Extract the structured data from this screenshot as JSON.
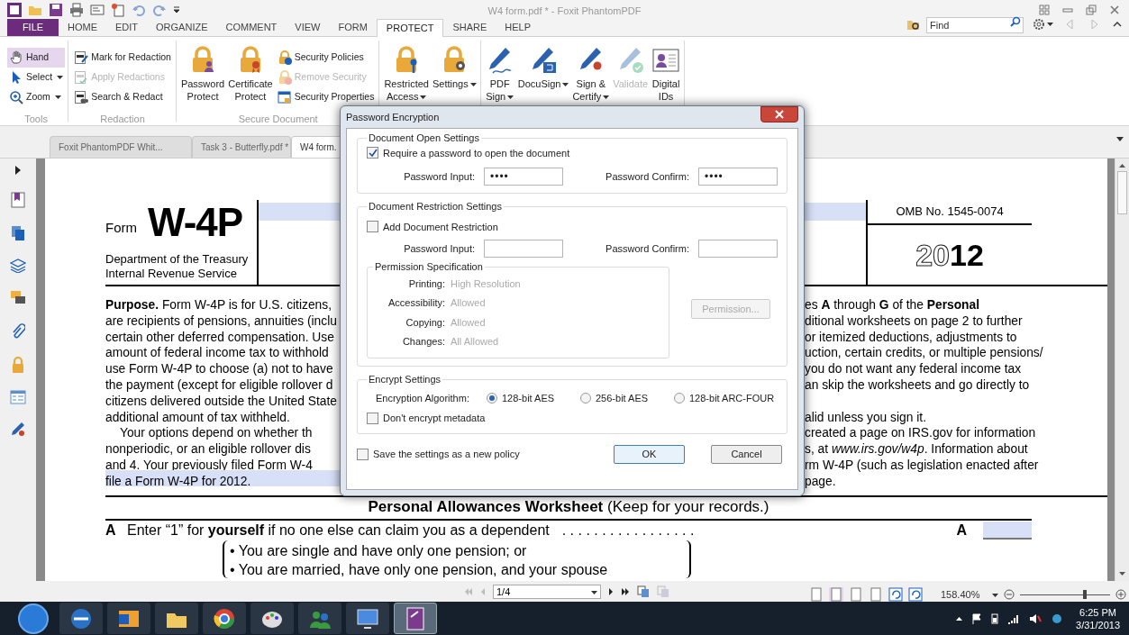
{
  "window": {
    "title": "W4 form.pdf * - Foxit PhantomPDF"
  },
  "menu_tabs": [
    {
      "label": "FILE",
      "kind": "file",
      "selected": false
    },
    {
      "label": "HOME",
      "kind": "tab",
      "selected": false
    },
    {
      "label": "EDIT",
      "kind": "tab",
      "selected": false
    },
    {
      "label": "ORGANIZE",
      "kind": "tab",
      "selected": false
    },
    {
      "label": "COMMENT",
      "kind": "tab",
      "selected": false
    },
    {
      "label": "VIEW",
      "kind": "tab",
      "selected": false
    },
    {
      "label": "FORM",
      "kind": "tab",
      "selected": false
    },
    {
      "label": "PROTECT",
      "kind": "tab",
      "selected": true
    },
    {
      "label": "SHARE",
      "kind": "tab",
      "selected": false
    },
    {
      "label": "HELP",
      "kind": "tab",
      "selected": false
    }
  ],
  "find": {
    "placeholder": "Find"
  },
  "ribbon_groups": [
    {
      "label": "Tools",
      "items": [
        {
          "kind": "small",
          "lines": [
            "Hand"
          ],
          "selected": true,
          "disabled": false,
          "dropdown": false
        },
        {
          "kind": "small",
          "lines": [
            "Select"
          ],
          "selected": false,
          "disabled": false,
          "dropdown": true
        },
        {
          "kind": "small",
          "lines": [
            "Zoom"
          ],
          "selected": false,
          "disabled": false,
          "dropdown": true
        }
      ]
    },
    {
      "label": "Redaction",
      "items": [
        {
          "kind": "small",
          "lines": [
            "Mark for Redaction"
          ],
          "disabled": false,
          "dropdown": false
        },
        {
          "kind": "small",
          "lines": [
            "Apply Redactions"
          ],
          "disabled": true,
          "dropdown": false
        },
        {
          "kind": "small",
          "lines": [
            "Search & Redact"
          ],
          "disabled": false,
          "dropdown": false
        }
      ]
    },
    {
      "label": "Secure Document",
      "items": [
        {
          "kind": "large",
          "lines": [
            "Password",
            "Protect"
          ],
          "disabled": false,
          "dropdown": false
        },
        {
          "kind": "large",
          "lines": [
            "Certificate",
            "Protect"
          ],
          "disabled": false,
          "dropdown": false
        },
        {
          "kind": "small",
          "lines": [
            "Security Policies"
          ],
          "disabled": false,
          "dropdown": false
        },
        {
          "kind": "small",
          "lines": [
            "Remove Security"
          ],
          "disabled": true,
          "dropdown": false
        },
        {
          "kind": "small",
          "lines": [
            "Security Properties"
          ],
          "disabled": false,
          "dropdown": false
        }
      ]
    },
    {
      "items": [
        {
          "kind": "large",
          "lines": [
            "Restricted",
            "Access"
          ],
          "disabled": false,
          "dropdown": true
        },
        {
          "kind": "large",
          "lines": [
            "Settings"
          ],
          "disabled": false,
          "dropdown": true
        }
      ]
    },
    {
      "items": [
        {
          "kind": "large",
          "lines": [
            "PDF",
            "Sign"
          ],
          "disabled": false,
          "dropdown": true
        },
        {
          "kind": "large",
          "lines": [
            "DocuSign"
          ],
          "disabled": false,
          "dropdown": true
        },
        {
          "kind": "large",
          "lines": [
            "Sign &",
            "Certify"
          ],
          "disabled": false,
          "dropdown": true
        },
        {
          "kind": "large",
          "lines": [
            "Validate"
          ],
          "disabled": true,
          "dropdown": false
        },
        {
          "kind": "large",
          "lines": [
            "Digital",
            "IDs"
          ],
          "disabled": false,
          "dropdown": false
        }
      ]
    }
  ],
  "document_tabs": [
    {
      "label": "Foxit PhantomPDF Whit...",
      "selected": false
    },
    {
      "label": "Task 3 - Butterfly.pdf *",
      "selected": false
    },
    {
      "label": "W4 form.",
      "selected": true
    }
  ],
  "document": {
    "form_label": "Form",
    "form_number": "W-4P",
    "department": [
      "Department of the Treasury",
      "Internal Revenue Service"
    ],
    "omb": "OMB No. 1545-0074",
    "year": "20**12**",
    "rows": [
      {
        "left": "**Purpose.** Form W-4P is for U.S. citizens,",
        "right": "es **A** through **G** of the **Personal**",
        "indented": false,
        "highlighted": false
      },
      {
        "left": "are recipients of pensions, annuities (inclu",
        "right": "ditional worksheets on page 2 to further",
        "indented": false,
        "highlighted": false
      },
      {
        "left": "certain other deferred compensation. Use",
        "right": "or itemized deductions, adjustments to",
        "indented": false,
        "highlighted": false
      },
      {
        "left": "amount of federal income tax to withhold",
        "right": "uction, certain credits, or multiple pensions/",
        "indented": false,
        "highlighted": false
      },
      {
        "left": "use Form W-4P to choose (a) not to have",
        "right": "you do not want any federal income tax",
        "indented": false,
        "highlighted": false
      },
      {
        "left": "the payment (except for eligible rollover d",
        "right": "an skip the worksheets and go directly to",
        "indented": false,
        "highlighted": false
      },
      {
        "left": "citizens delivered outside the United State",
        "indented": false,
        "highlighted": false
      },
      {
        "left": "additional amount of tax withheld.",
        "right": "alid unless you sign it.",
        "indented": false,
        "highlighted": false
      },
      {
        "left": "Your options depend on whether th",
        "right": "created a page on IRS.gov for information",
        "indented": true,
        "highlighted": false
      },
      {
        "left": "nonperiodic, or an eligible rollover dis",
        "right": "s, at *www.irs.gov/w4p*. Information about",
        "indented": false,
        "highlighted": false
      },
      {
        "left": "and 4. Your previously filed Form W-4",
        "right": "rm W-4P (such as legislation enacted after",
        "indented": false,
        "highlighted": false
      },
      {
        "left": "file a Form W-4P for 2012.",
        "right": "page.",
        "indented": false,
        "highlighted": true
      }
    ],
    "worksheet_title": "**Personal Allowances Worksheet** (Keep for your records.)",
    "line_a": {
      "letter": "A",
      "text": "Enter “1” for **yourself** if no one else can claim you as a dependent",
      "dots": ". . . . . . . . . . . . . . . . .",
      "box_letter": "A"
    },
    "bullets": [
      "• You are single and have only one pension; or",
      "• You are married, have only one pension, and your spouse"
    ]
  },
  "dialog": {
    "title": "Password Encryption",
    "open_settings": {
      "title": "Document Open Settings",
      "require_password": {
        "label": "Require a password to open the document",
        "checked": true
      },
      "password_input": {
        "label": "Password Input:",
        "value": "••••"
      },
      "password_confirm": {
        "label": "Password Confirm:",
        "value": "••••"
      }
    },
    "restriction_settings": {
      "title": "Document Restriction Settings",
      "add_restriction": {
        "label": "Add Document Restriction",
        "checked": false
      },
      "password_input": {
        "label": "Password Input:"
      },
      "password_confirm": {
        "label": "Password Confirm:"
      },
      "permission_specification": {
        "title": "Permission Specification",
        "rows": [
          {
            "label": "Printing:",
            "value": "High Resolution"
          },
          {
            "label": "Accessibility:",
            "value": "Allowed"
          },
          {
            "label": "Copying:",
            "value": "Allowed"
          },
          {
            "label": "Changes:",
            "value": "All Allowed"
          }
        ]
      },
      "permission_button": {
        "label": "Permission...",
        "disabled": true
      }
    },
    "encrypt_settings": {
      "title": "Encrypt Settings",
      "algorithm_label": "Encryption Algorithm:",
      "algorithms": [
        {
          "label": "128-bit AES",
          "selected": true
        },
        {
          "label": "256-bit AES",
          "selected": false
        },
        {
          "label": "128-bit ARC-FOUR",
          "selected": false
        }
      ],
      "dont_encrypt_metadata": {
        "label": "Don't encrypt metadata",
        "checked": false
      }
    },
    "save_as_policy": {
      "label": "Save the settings as a new policy",
      "checked": false
    },
    "buttons": [
      {
        "label": "OK",
        "kind": "default"
      },
      {
        "label": "Cancel",
        "kind": "normal"
      }
    ]
  },
  "status_bar": {
    "page": "1/4",
    "zoom": "158.40%",
    "zoom_slider": {
      "level": 0.72
    }
  },
  "taskbar": {
    "apps": [
      {
        "selected": false
      },
      {
        "selected": false
      },
      {
        "selected": false
      },
      {
        "selected": false
      },
      {
        "selected": false
      },
      {
        "selected": false
      },
      {
        "selected": false
      },
      {
        "selected": true
      }
    ],
    "clock": {
      "time": "6:25 PM",
      "date": "3/31/2013"
    }
  }
}
